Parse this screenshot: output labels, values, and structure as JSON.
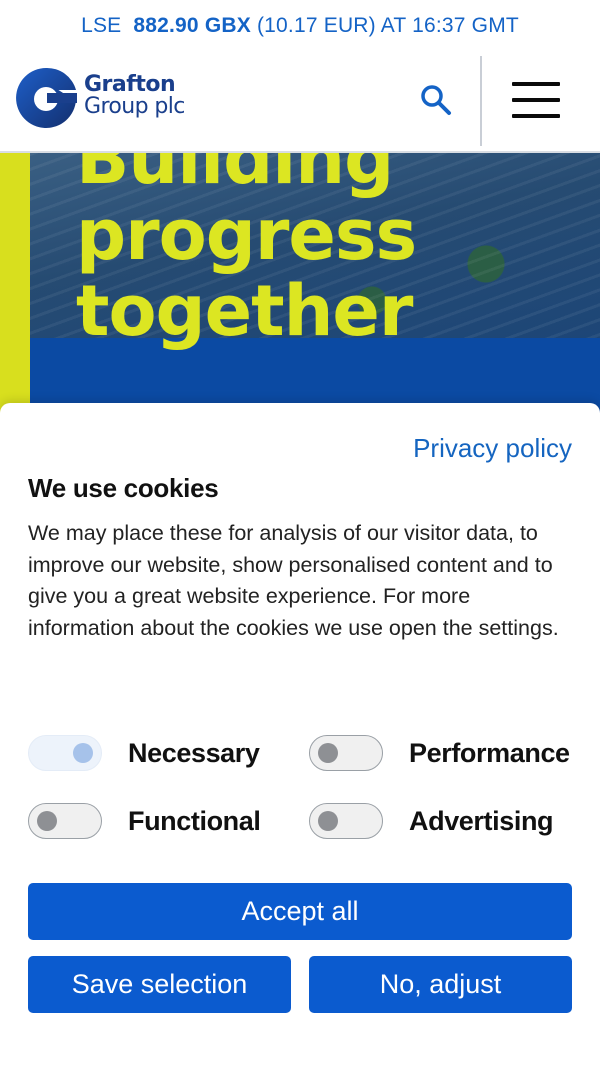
{
  "ticker": {
    "exchange": "LSE",
    "price": "882.90 GBX",
    "eur": "(10.17 EUR) AT 16:37 GMT"
  },
  "header": {
    "logo_line1": "Grafton",
    "logo_line2": "Group plc",
    "search_icon": "search-icon",
    "menu_icon": "hamburger-menu-icon",
    "brand_color": "#1a3f8c"
  },
  "hero": {
    "title_line0": "Building",
    "title_line1": "progress",
    "title_line2": "together",
    "accent_color": "#d8df1e"
  },
  "cookie_modal": {
    "privacy_link": "Privacy policy",
    "title": "We use cookies",
    "description": "We may place these for analysis of our visitor data, to improve our website, show personalised content and to give you a great website experience. For more information about the cookies we use open the settings.",
    "options": [
      {
        "label": "Necessary",
        "enabled": true
      },
      {
        "label": "Performance",
        "enabled": false
      },
      {
        "label": "Functional",
        "enabled": false
      },
      {
        "label": "Advertising",
        "enabled": false
      }
    ],
    "accept_all": "Accept all",
    "save_selection": "Save selection",
    "no_adjust": "No, adjust",
    "button_color": "#0b5bcf"
  }
}
